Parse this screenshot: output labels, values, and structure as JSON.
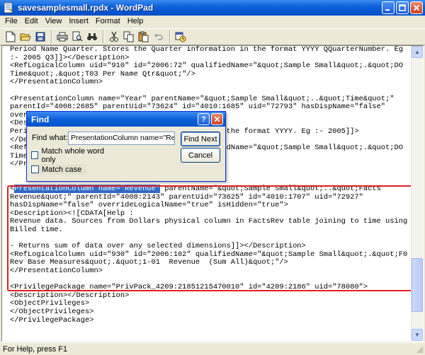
{
  "window": {
    "title": "savesamplesmall.rpdx - WordPad",
    "minimize_label": "_",
    "maximize_label": "□",
    "close_label": "X"
  },
  "menu": {
    "items": [
      "File",
      "Edit",
      "View",
      "Insert",
      "Format",
      "Help"
    ]
  },
  "toolbar": {
    "buttons": [
      "new-icon",
      "open-icon",
      "save-icon",
      "print-icon",
      "print-preview-icon",
      "find-icon",
      "cut-icon",
      "copy-icon",
      "paste-icon",
      "undo-icon",
      "insert-date-icon"
    ]
  },
  "document": {
    "lines": [
      "Period Name Quarter. Stores the Quarter information in the format YYYY QQuarterNumber. Eg",
      ":- 2005 Q3]]></Description>",
      "<RefLogicalColumn uid=\"910\" id=\"2006:72\" qualifiedName=\"&quot;Sample Small&quot;.&quot;DO",
      "Time&quot;.&quot;T03 Per Name Qtr&quot;\"/>",
      "</PresentationColumn>",
      "",
      "<PresentationColumn name=\"Year\" parentName=\"&quot;Sample Small&quot;..&quot;Time&quot;\"",
      "parentId=\"4008:2685\" parentUid=\"73624\" id=\"4010:1685\" uid=\"72793\" hasDispName=\"false\"",
      "overrideLogicalName=\"true\" isHidden=\"true\">",
      "<Description><![CDATA[Help :",
      "Period Name Year. Stores the Year information in the format YYYY. Eg :- 2005]]>",
      "</Description>",
      "<RefLogicalColumn uid=\"911\" id=\"2006:73\" qualifiedName=\"&quot;Sample Small&quot;.&quot;DO",
      "Time&quot;.&quot;T04 Per Name Year&quot;\"/>",
      "</PresentationColumn>",
      "",
      "",
      "<PresentationColumn name=\"Revenue\" parentName=\"&quot;Sample Small&quot;..&quot;Facts",
      "Revenue&quot;\" parentId=\"4008:2143\" parentUid=\"73625\" id=\"4010:1707\" uid=\"72927\"",
      "hasDispName=\"false\" overrideLogicalName=\"true\" isHidden=\"true\">",
      "<Description><![CDATA[Help :",
      "Revenue data. Sources from Dollars physical column in FactsRev table joining to time using",
      "Billed time.",
      "",
      "- Returns sum of data over any selected dimensions]]></Description>",
      "<RefLogicalColumn uid=\"930\" id=\"2006:102\" qualifiedName=\"&quot;Sample Small&quot;.&quot;F0",
      "Rev Base Measures&quot;.&quot;1-01  Revenue  (Sum All)&quot;\"/>",
      "</PresentationColumn>",
      "",
      "<PrivilegePackage name=\"PrivPack_4209:21851215470010\" id=\"4209:2186\" uid=\"78080\">",
      "<Description></Description>",
      "<ObjectPrivileges>",
      "</ObjectPrivileges>",
      "</PrivilegePackage>"
    ],
    "selected_text": "PresentationColumn name=\"Revenue\"",
    "selected_line_rest": " parentName=\"&quot;Sample Small&quot;..&quot;Facts"
  },
  "find_dialog": {
    "title": "Find",
    "help_label": "?",
    "close_label": "X",
    "find_what_label": "Find what:",
    "find_what_value": "PresentationColumn name=\"Revenue\"",
    "find_next_label": "Find Next",
    "cancel_label": "Cancel",
    "match_whole_word_label": "Match whole word only",
    "match_case_label": "Match case",
    "match_whole_word_checked": false,
    "match_case_checked": false
  },
  "status": {
    "text": "For Help, press F1"
  },
  "colors": {
    "titlebar": "#0a5fd8",
    "selection": "#316ac5",
    "highlight_box": "#e02020"
  }
}
